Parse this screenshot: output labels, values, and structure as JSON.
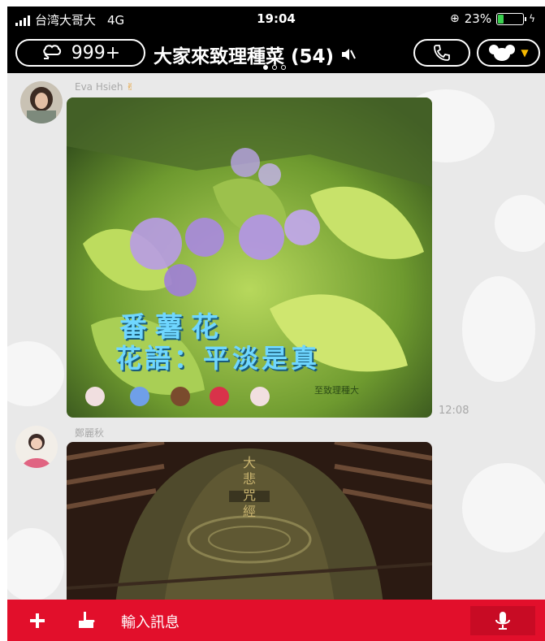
{
  "status_bar": {
    "carrier": "台湾大哥大",
    "network": "4G",
    "time": "19:04",
    "battery_percent": "23%",
    "battery_level": 0.23,
    "battery_color": "#3ad14f"
  },
  "header": {
    "back_label": "999+",
    "title": "大家來致理種菜 (54)",
    "page_indicator": {
      "count": 3,
      "active": 0
    }
  },
  "messages": [
    {
      "sender": "Eva Hsieh",
      "sender_emoji": "✌",
      "image_caption_line1": "番薯花",
      "image_caption_line2": "花語：平淡是真",
      "image_signature": "至致理種大",
      "time": "12:08"
    },
    {
      "sender": "鄭麗秋",
      "image_bell_text": "大悲咒經"
    }
  ],
  "input_bar": {
    "placeholder": "輸入訊息"
  },
  "colors": {
    "header_bg": "#000000",
    "input_bar": "#e20f2b",
    "chat_bg": "#e9e9e9"
  }
}
